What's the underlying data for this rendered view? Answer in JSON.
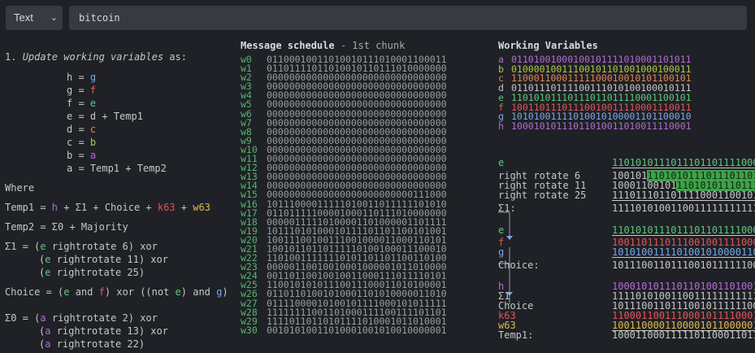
{
  "toolbar": {
    "select_value": "Text",
    "search_value": "bitcoin"
  },
  "steps": {
    "heading_num": "1.",
    "heading_text": "Update working variables",
    "heading_suffix": " as:",
    "assignments": [
      {
        "lhs": "h = ",
        "rhs": "g",
        "cls": "g"
      },
      {
        "lhs": "g = ",
        "rhs": "f",
        "cls": "f"
      },
      {
        "lhs": "f = ",
        "rhs": "e",
        "cls": "e"
      },
      {
        "lhs": "e = ",
        "rhs": "d + Temp1",
        "cls": ""
      },
      {
        "lhs": "d = ",
        "rhs": "c",
        "cls": "c"
      },
      {
        "lhs": "c = ",
        "rhs": "b",
        "cls": "b"
      },
      {
        "lhs": "b = ",
        "rhs": "a",
        "cls": "a"
      },
      {
        "lhs": "a = ",
        "rhs": "Temp1 + Temp2",
        "cls": ""
      }
    ],
    "where": "Where",
    "temp1_label": "Temp1 = ",
    "temp1_parts": [
      "h",
      " + Σ1 + Choice + ",
      "k63",
      " + ",
      "w63"
    ],
    "temp2": "Temp2 = Σ0 + Majority",
    "sigma1_label": "Σ1 = (",
    "sigma1_lines": [
      "e rightrotate 6) xor",
      "e rightrotate 11) xor",
      "e rightrotate 25)"
    ],
    "choice_parts": [
      "Choice = (",
      "e",
      " and ",
      "f",
      ") xor ((not ",
      "e",
      ") and ",
      "g",
      ")"
    ],
    "sigma0_label": "Σ0 = (",
    "sigma0_lines": [
      "a rightrotate 2) xor",
      "a rightrotate 13) xor",
      "a rightrotate 22)"
    ]
  },
  "schedule": {
    "title": "Message schedule",
    "subtitle": " - 1st chunk",
    "rows": [
      {
        "label": "w0",
        "value": "01100010011010010111010001100011"
      },
      {
        "label": "w1",
        "value": "01101111011010010110111010000000"
      },
      {
        "label": "w2",
        "value": "00000000000000000000000000000000"
      },
      {
        "label": "w3",
        "value": "00000000000000000000000000000000"
      },
      {
        "label": "w4",
        "value": "00000000000000000000000000000000"
      },
      {
        "label": "w5",
        "value": "00000000000000000000000000000000"
      },
      {
        "label": "w6",
        "value": "00000000000000000000000000000000"
      },
      {
        "label": "w7",
        "value": "00000000000000000000000000000000"
      },
      {
        "label": "w8",
        "value": "00000000000000000000000000000000"
      },
      {
        "label": "w9",
        "value": "00000000000000000000000000000000"
      },
      {
        "label": "w10",
        "value": "00000000000000000000000000000000"
      },
      {
        "label": "w11",
        "value": "00000000000000000000000000000000"
      },
      {
        "label": "w12",
        "value": "00000000000000000000000000000000"
      },
      {
        "label": "w13",
        "value": "00000000000000000000000000000000"
      },
      {
        "label": "w14",
        "value": "00000000000000000000000000000000"
      },
      {
        "label": "w15",
        "value": "00000000000000000000000000111000"
      },
      {
        "label": "w16",
        "value": "10111000011111010011011111101010"
      },
      {
        "label": "w17",
        "value": "01101111100001000110111010000000"
      },
      {
        "label": "w18",
        "value": "00000111110100001101000001101111"
      },
      {
        "label": "w19",
        "value": "10111010100010111101101100101001"
      },
      {
        "label": "w20",
        "value": "10011100100111001000011000110101"
      },
      {
        "label": "w21",
        "value": "10010110110111110100100011100010"
      },
      {
        "label": "w22",
        "value": "11010011111110101101101100110100"
      },
      {
        "label": "w23",
        "value": "00000110010010001000001011010000"
      },
      {
        "label": "w24",
        "value": "00110110010010011000111011110101"
      },
      {
        "label": "w25",
        "value": "11001010101110011100011010100001"
      },
      {
        "label": "w26",
        "value": "01101101001010001101010000011010"
      },
      {
        "label": "w27",
        "value": "01111000010100101111000101011111"
      },
      {
        "label": "w28",
        "value": "11111111001101000111100111101101"
      },
      {
        "label": "w29",
        "value": "11110110110101111010001011010001"
      },
      {
        "label": "w30",
        "value": "00101010011010001001010010000001"
      }
    ]
  },
  "working": {
    "title": "Working Variables",
    "rows": [
      {
        "label": "a",
        "value": "01101001000100101111010001101011",
        "color": "#b56ad9"
      },
      {
        "label": "b",
        "value": "01000010011100101101001000100011",
        "color": "#b3c845"
      },
      {
        "label": "c",
        "value": "11000110001111100010010101100101",
        "color": "#e8844a"
      },
      {
        "label": "d",
        "value": "01101110111100111010100100010111",
        "color": "#c5c8c6"
      },
      {
        "label": "e",
        "value": "11010101110111011011110001100101",
        "color": "#5fc87a"
      },
      {
        "label": "f",
        "value": "10011011101110010011110001110011",
        "color": "#e15757"
      },
      {
        "label": "g",
        "value": "10101001111010010100001101100010",
        "color": "#7ba7e6"
      },
      {
        "label": "h",
        "value": "10001010111011010011010011110001",
        "color": "#b56ad9"
      }
    ]
  },
  "calc": {
    "e_label": "e",
    "e_value": "1101010111011101101111000",
    "rr6_label": "right rotate 6",
    "rr6_pre": "100101",
    "rr6_hl": "1101010111011101101",
    "rr11_label": "right rotate 11",
    "rr11_pre": "10001100101",
    "rr11_hl": "11010101110111",
    "rr25_label": "right rotate 25",
    "rr25_value": "1110111011011110001100101",
    "s1_label": "Σ1:",
    "s1_value": "1111010100110011111111111",
    "e2_label": "e",
    "e2_value": "1101010111011101101111000",
    "f_label": "f",
    "f_value": "1001101110111001001111000",
    "g_label": "g",
    "g_value": "1010100111101001010000110",
    "choice_label": "Choice:",
    "choice_value": "1011100110111001011111100",
    "h_label": "h",
    "h_value": "1000101011101101001101001",
    "sig1_label": "Σ1",
    "sig1_value": "1111010100110011111111111",
    "choice2_label": "Choice",
    "choice2_value": "1011100110111001011111100",
    "k63_label": "k63",
    "k63_value": "1100011001110001011110001",
    "w63_label": "w63",
    "w63_value": "1001100001100001011000001",
    "temp1_label": "Temp1:",
    "temp1_value": "1000110001111101100011011"
  },
  "icons": {
    "select_chevron": "chevron-down-icon"
  }
}
